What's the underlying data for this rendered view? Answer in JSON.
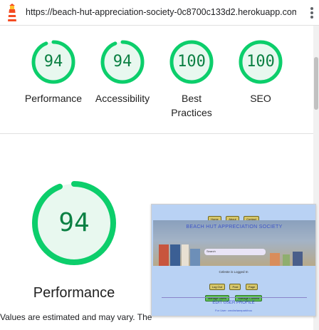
{
  "url_bar": {
    "url": "https://beach-hut-appreciation-society-0c8700c133d2.herokuapp.com..."
  },
  "scores": [
    {
      "name": "Performance",
      "value": "94"
    },
    {
      "name": "Accessibility",
      "value": "94"
    },
    {
      "name": "Best Practices",
      "value": "100"
    },
    {
      "name": "SEO",
      "value": "100"
    }
  ],
  "performance_gauge": {
    "value": "94",
    "label": "Performance"
  },
  "note": {
    "line1": "Values are estimated and may vary. The",
    "line2_before": "",
    "line2_link": "",
    "line2_after": ""
  },
  "screenshot": {
    "nav": [
      "Home",
      "About",
      "Contact"
    ],
    "title": "BEACH HUT APPRECIATION SOCIETY",
    "search_placeholder": "Search",
    "logged_in": "Celeste is Logged In",
    "row1": [
      "Log Out",
      "Post",
      "Page"
    ],
    "row2": [
      "Manage Users",
      "Manage Content"
    ],
    "edit_title": "EDIT USER PROFILE",
    "edit_for": "For User: cmcfarlaneparkhou"
  },
  "colors": {
    "pass_green": "#0cce6b",
    "pass_text": "#0b8043",
    "pass_fill": "#e8f8ef"
  },
  "icons": {
    "logo": "lighthouse-icon",
    "menu": "more-vert-icon"
  }
}
